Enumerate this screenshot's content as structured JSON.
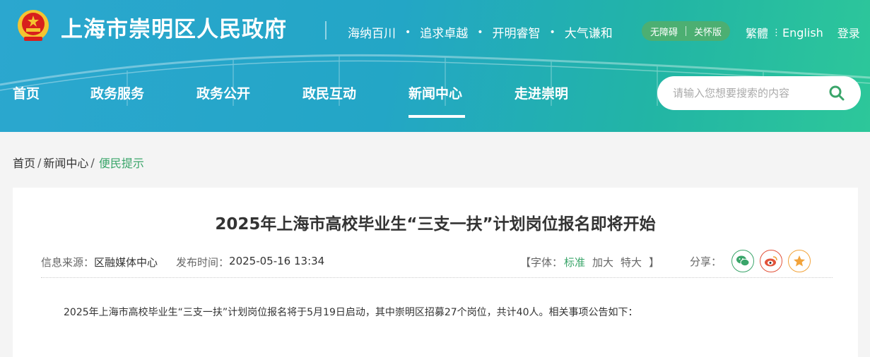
{
  "header": {
    "site_title": "上海市崇明区人民政府",
    "slogans": [
      "海纳百川",
      "追求卓越",
      "开明睿智",
      "大气谦和"
    ],
    "accessibility": [
      "无障碍",
      "关怀版"
    ],
    "traditional": "繁體",
    "english": "English",
    "login": "登录"
  },
  "nav": {
    "items": [
      "首页",
      "政务服务",
      "政务公开",
      "政民互动",
      "新闻中心",
      "走进崇明"
    ],
    "active": "新闻中心"
  },
  "search": {
    "placeholder": "请输入您想要搜索的内容",
    "icon": "search-icon"
  },
  "breadcrumb": {
    "items": [
      "首页",
      "新闻中心"
    ],
    "current": "便民提示"
  },
  "article": {
    "title": "2025年上海市高校毕业生“三支一扶”计划岗位报名即将开始",
    "source_label": "信息来源：",
    "source": "区融媒体中心",
    "time_label": "发布时间：",
    "time": "2025-05-16 13:34",
    "font_label_open": "【字体：",
    "font_options": [
      "标准",
      "加大",
      "特大"
    ],
    "font_label_close": "】",
    "share_label": "分享：",
    "share_icons": [
      "wechat-icon",
      "weibo-icon",
      "qzone-icon"
    ],
    "paragraph": "2025年上海市高校毕业生“三支一扶”计划岗位报名将于5月19日启动，其中崇明区招募27个岗位，共计40人。相关事项公告如下："
  },
  "colors": {
    "accent_green": "#3aa56a",
    "header_start": "#2ba7cf",
    "header_end": "#2dc79a"
  }
}
